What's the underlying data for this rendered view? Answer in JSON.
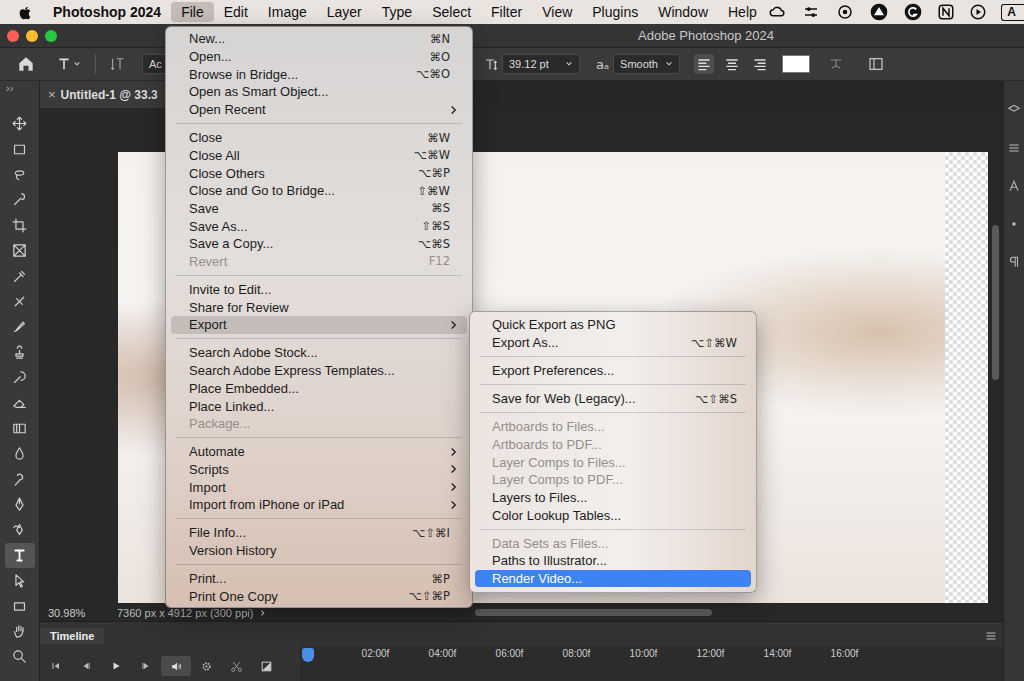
{
  "menu_bar": {
    "app": "Photoshop 2024",
    "items": [
      {
        "label": "File",
        "selected": true
      },
      {
        "label": "Edit",
        "selected": false
      },
      {
        "label": "Image",
        "selected": false
      },
      {
        "label": "Layer",
        "selected": false
      },
      {
        "label": "Type",
        "selected": false
      },
      {
        "label": "Select",
        "selected": false
      },
      {
        "label": "Filter",
        "selected": false
      },
      {
        "label": "View",
        "selected": false
      },
      {
        "label": "Plugins",
        "selected": false
      },
      {
        "label": "Window",
        "selected": false
      },
      {
        "label": "Help",
        "selected": false
      }
    ],
    "input_source": "A"
  },
  "window": {
    "title": "Adobe Photoshop 2024"
  },
  "options_bar": {
    "font_family": "Ac",
    "font_size": "39.12 pt",
    "antialias_icon": "aₐ",
    "antialias": "Smooth",
    "alignment": [
      {
        "kind": "left",
        "selected": true
      },
      {
        "kind": "center",
        "selected": false
      },
      {
        "kind": "right",
        "selected": false
      }
    ]
  },
  "toolbar": {
    "collapse": "››",
    "tools": [
      {
        "kind": "move",
        "selected": false
      },
      {
        "kind": "marquee",
        "selected": false
      },
      {
        "kind": "lasso",
        "selected": false
      },
      {
        "kind": "quick-select",
        "selected": false
      },
      {
        "kind": "crop",
        "selected": false
      },
      {
        "kind": "frame",
        "selected": false
      },
      {
        "kind": "eyedropper",
        "selected": false
      },
      {
        "kind": "healing",
        "selected": false
      },
      {
        "kind": "brush",
        "selected": false
      },
      {
        "kind": "stamp",
        "selected": false
      },
      {
        "kind": "history-brush",
        "selected": false
      },
      {
        "kind": "eraser",
        "selected": false
      },
      {
        "kind": "gradient",
        "selected": false
      },
      {
        "kind": "blur",
        "selected": false
      },
      {
        "kind": "dodge",
        "selected": false
      },
      {
        "kind": "pen",
        "selected": false
      },
      {
        "kind": "curvature-pen",
        "selected": false
      },
      {
        "kind": "type",
        "selected": true
      },
      {
        "kind": "path-select",
        "selected": false
      },
      {
        "kind": "rectangle",
        "selected": false
      },
      {
        "kind": "hand",
        "selected": false
      },
      {
        "kind": "zoom",
        "selected": false
      }
    ]
  },
  "document_tab": {
    "close": "×",
    "title": "Untitled-1 @ 33.3"
  },
  "status_bar": {
    "zoom": "30.98%",
    "size": "7360 px x 4912 px (300 ppi)"
  },
  "timeline": {
    "title": "Timeline",
    "ticks": [
      "02:00f",
      "04:00f",
      "06:00f",
      "08:00f",
      "10:00f",
      "12:00f",
      "14:00f",
      "16:00f"
    ]
  },
  "file_menu": {
    "groups": [
      [
        {
          "label": "New...",
          "shortcut": "⌘N",
          "disabled": false,
          "submenu": false,
          "selected": false
        },
        {
          "label": "Open...",
          "shortcut": "⌘O",
          "disabled": false,
          "submenu": false,
          "selected": false
        },
        {
          "label": "Browse in Bridge...",
          "shortcut": "⌥⌘O",
          "disabled": false,
          "submenu": false,
          "selected": false
        },
        {
          "label": "Open as Smart Object...",
          "disabled": false,
          "submenu": false,
          "selected": false
        },
        {
          "label": "Open Recent",
          "disabled": false,
          "submenu": true,
          "selected": false
        }
      ],
      [
        {
          "label": "Close",
          "shortcut": "⌘W",
          "disabled": false,
          "submenu": false,
          "selected": false
        },
        {
          "label": "Close All",
          "shortcut": "⌥⌘W",
          "disabled": false,
          "submenu": false,
          "selected": false
        },
        {
          "label": "Close Others",
          "shortcut": "⌥⌘P",
          "disabled": false,
          "submenu": false,
          "selected": false
        },
        {
          "label": "Close and Go to Bridge...",
          "shortcut": "⇧⌘W",
          "disabled": false,
          "submenu": false,
          "selected": false
        },
        {
          "label": "Save",
          "shortcut": "⌘S",
          "disabled": false,
          "submenu": false,
          "selected": false
        },
        {
          "label": "Save As...",
          "shortcut": "⇧⌘S",
          "disabled": false,
          "submenu": false,
          "selected": false
        },
        {
          "label": "Save a Copy...",
          "shortcut": "⌥⌘S",
          "disabled": false,
          "submenu": false,
          "selected": false
        },
        {
          "label": "Revert",
          "shortcut": "F12",
          "disabled": true,
          "submenu": false,
          "selected": false
        }
      ],
      [
        {
          "label": "Invite to Edit...",
          "disabled": false,
          "submenu": false,
          "selected": false
        },
        {
          "label": "Share for Review",
          "disabled": false,
          "submenu": false,
          "selected": false
        },
        {
          "label": "Export",
          "disabled": false,
          "submenu": true,
          "selected": true
        }
      ],
      [
        {
          "label": "Search Adobe Stock...",
          "disabled": false,
          "submenu": false,
          "selected": false
        },
        {
          "label": "Search Adobe Express Templates...",
          "disabled": false,
          "submenu": false,
          "selected": false
        },
        {
          "label": "Place Embedded...",
          "disabled": false,
          "submenu": false,
          "selected": false
        },
        {
          "label": "Place Linked...",
          "disabled": false,
          "submenu": false,
          "selected": false
        },
        {
          "label": "Package...",
          "disabled": true,
          "submenu": false,
          "selected": false
        }
      ],
      [
        {
          "label": "Automate",
          "disabled": false,
          "submenu": true,
          "selected": false
        },
        {
          "label": "Scripts",
          "disabled": false,
          "submenu": true,
          "selected": false
        },
        {
          "label": "Import",
          "disabled": false,
          "submenu": true,
          "selected": false
        },
        {
          "label": "Import from iPhone or iPad",
          "disabled": false,
          "submenu": true,
          "selected": false
        }
      ],
      [
        {
          "label": "File Info...",
          "shortcut": "⌥⇧⌘I",
          "disabled": false,
          "submenu": false,
          "selected": false
        },
        {
          "label": "Version History",
          "disabled": false,
          "submenu": false,
          "selected": false
        }
      ],
      [
        {
          "label": "Print...",
          "shortcut": "⌘P",
          "disabled": false,
          "submenu": false,
          "selected": false
        },
        {
          "label": "Print One Copy",
          "shortcut": "⌥⇧⌘P",
          "disabled": false,
          "submenu": false,
          "selected": false
        }
      ]
    ]
  },
  "export_submenu": {
    "groups": [
      [
        {
          "label": "Quick Export as PNG",
          "disabled": false,
          "selected": false
        },
        {
          "label": "Export As...",
          "shortcut": "⌥⇧⌘W",
          "disabled": false,
          "selected": false
        }
      ],
      [
        {
          "label": "Export Preferences...",
          "disabled": false,
          "selected": false
        }
      ],
      [
        {
          "label": "Save for Web (Legacy)...",
          "shortcut": "⌥⇧⌘S",
          "disabled": false,
          "selected": false
        }
      ],
      [
        {
          "label": "Artboards to Files...",
          "disabled": true,
          "selected": false
        },
        {
          "label": "Artboards to PDF...",
          "disabled": true,
          "selected": false
        },
        {
          "label": "Layer Comps to Files...",
          "disabled": true,
          "selected": false
        },
        {
          "label": "Layer Comps to PDF...",
          "disabled": true,
          "selected": false
        },
        {
          "label": "Layers to Files...",
          "disabled": false,
          "selected": false
        },
        {
          "label": "Color Lookup Tables...",
          "disabled": false,
          "selected": false
        }
      ],
      [
        {
          "label": "Data Sets as Files...",
          "disabled": true,
          "selected": false
        },
        {
          "label": "Paths to Illustrator...",
          "disabled": false,
          "selected": false
        },
        {
          "label": "Render Video...",
          "disabled": false,
          "selected": true
        }
      ]
    ]
  }
}
